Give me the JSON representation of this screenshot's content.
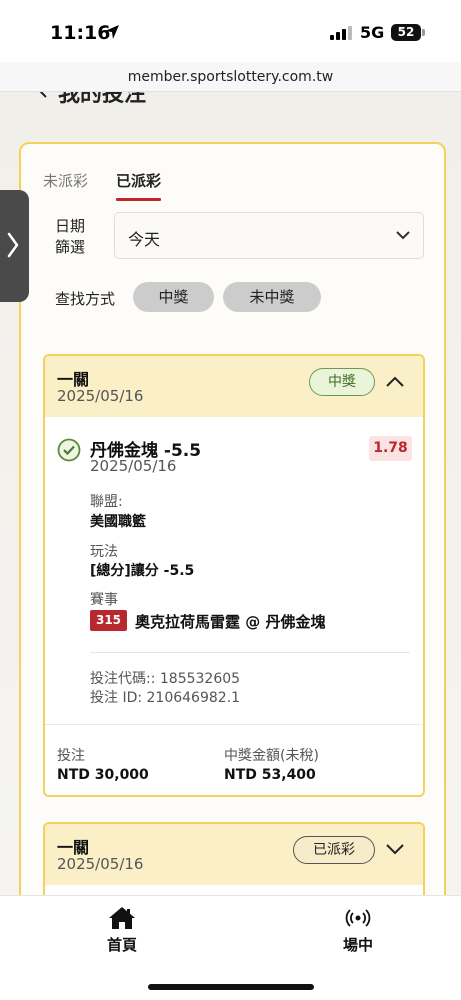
{
  "status_bar": {
    "time": "11:16",
    "network": "5G",
    "battery": "52"
  },
  "url_bar": {
    "url": "member.sportslottery.com.tw"
  },
  "page": {
    "title": "我的投注"
  },
  "tabs": [
    {
      "label": "未派彩",
      "active": false
    },
    {
      "label": "已派彩",
      "active": true
    }
  ],
  "filter": {
    "date_label": "日期篩選",
    "date_value": "今天",
    "search_label": "查找方式",
    "pills": [
      "中獎",
      "未中獎"
    ]
  },
  "bets": [
    {
      "type": "一關",
      "date": "2025/05/16",
      "status": "中獎",
      "expanded": true,
      "selection": {
        "name": "丹佛金塊 -5.5",
        "date": "2025/05/16",
        "odds": "1.78",
        "league_label": "聯盟:",
        "league": "美國職籃",
        "market_label": "玩法",
        "market": "[總分]讓分 -5.5",
        "event_label": "賽事",
        "match_number": "315",
        "match": "奧克拉荷馬雷霆 @ 丹佛金塊"
      },
      "bet_code": "投注代碼:: 185532605",
      "bet_id": "投注 ID: 210646982.1",
      "stake_label": "投注",
      "stake": "NTD 30,000",
      "payout_label": "中獎金額(未稅)",
      "payout": "NTD 53,400"
    },
    {
      "type": "一關",
      "date": "2025/05/16",
      "status": "已派彩",
      "expanded": false
    }
  ],
  "bottom_nav": [
    {
      "label": "首頁",
      "icon": "home-icon"
    },
    {
      "label": "場中",
      "icon": "live-broadcast-icon"
    }
  ],
  "colors": {
    "accent": "#c0272d",
    "highlight": "#f3d25a",
    "win_green": "#3f6d27"
  }
}
